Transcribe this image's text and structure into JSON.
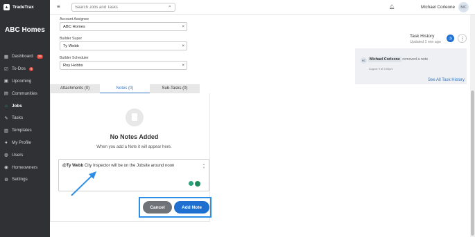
{
  "app": {
    "brand": "TradeTrax",
    "company": "ABC Homes"
  },
  "sidebar": {
    "items": [
      {
        "label": "Dashboard",
        "icon": "calendar-icon",
        "badge": "28"
      },
      {
        "label": "To-Dos",
        "icon": "todo-icon",
        "badge": "6"
      },
      {
        "label": "Upcoming",
        "icon": "upcoming-icon"
      },
      {
        "label": "Communities",
        "icon": "building-icon"
      },
      {
        "label": "Jobs",
        "icon": "home-icon",
        "active": true
      },
      {
        "label": "Tasks",
        "icon": "wrench-icon"
      },
      {
        "label": "Templates",
        "icon": "templates-icon"
      },
      {
        "label": "My Profile",
        "icon": "profile-icon"
      },
      {
        "label": "Users",
        "icon": "users-icon"
      },
      {
        "label": "Homeowners",
        "icon": "homeowners-icon"
      },
      {
        "label": "Settings",
        "icon": "gear-icon"
      }
    ]
  },
  "topbar": {
    "search_placeholder": "Search Jobs and Tasks",
    "user_name": "Michael Corleone",
    "user_initials": "MC"
  },
  "fields": [
    {
      "label": "Account Assignee",
      "value": "ABC Homes"
    },
    {
      "label": "Builder Super",
      "value": "Ty Webb"
    },
    {
      "label": "Builder Scheduler",
      "value": "Roy Hobbs"
    }
  ],
  "tabs": [
    {
      "label": "Attachments (0)"
    },
    {
      "label": "Notes (0)",
      "active": true
    },
    {
      "label": "Sub-Tasks (0)"
    }
  ],
  "notes": {
    "empty_title": "No Notes Added",
    "empty_sub": "When you add a Note it will appear here.",
    "draft_mention": "@Ty Webb",
    "draft_text": " City Inspector will be on the Jobsite around noon",
    "char_count": "",
    "cancel_label": "Cancel",
    "add_label": "Add Note"
  },
  "history": {
    "title": "Task History",
    "updated": "Updated 1 min ago",
    "entry_initials": "MC",
    "entry_name": "Michael Corleone",
    "entry_action": "removed a note",
    "entry_time": "August 9 at 3:56pm",
    "see_all": "See All Task History"
  },
  "colors": {
    "accent": "#1f6fd0",
    "sidebar": "#2f3135",
    "highlight": "#2d8ee6",
    "active_nav": "#33b46f"
  }
}
